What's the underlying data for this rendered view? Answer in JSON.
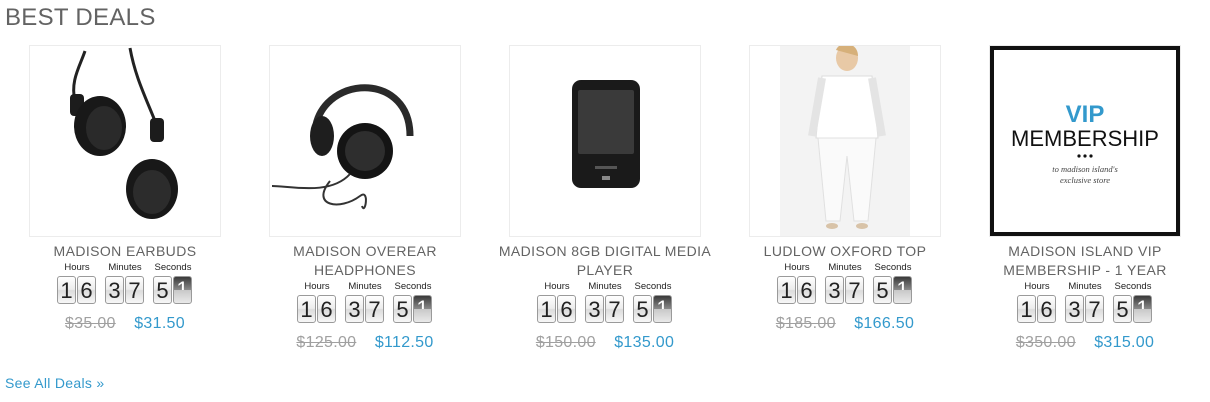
{
  "section": {
    "title": "BEST DEALS",
    "see_all": "See All Deals »"
  },
  "timer_labels": {
    "hours": "Hours",
    "minutes": "Minutes",
    "seconds": "Seconds"
  },
  "colors": {
    "price_special": "#3399cc",
    "price_old": "#a0a0a0",
    "title": "#636363"
  },
  "products": [
    {
      "name": "MADISON EARBUDS",
      "image": "earbuds-image",
      "digits": [
        "1",
        "6",
        "3",
        "7",
        "5",
        "1"
      ],
      "old_price": "$35.00",
      "price": "$31.50"
    },
    {
      "name": "MADISON OVEREAR HEADPHONES",
      "image": "headphones-image",
      "digits": [
        "1",
        "6",
        "3",
        "7",
        "5",
        "1"
      ],
      "old_price": "$125.00",
      "price": "$112.50"
    },
    {
      "name": "MADISON 8GB DIGITAL MEDIA PLAYER",
      "image": "media-player-image",
      "digits": [
        "1",
        "6",
        "3",
        "7",
        "5",
        "1"
      ],
      "old_price": "$150.00",
      "price": "$135.00"
    },
    {
      "name": "LUDLOW OXFORD TOP",
      "image": "oxford-top-image",
      "digits": [
        "1",
        "6",
        "3",
        "7",
        "5",
        "1"
      ],
      "old_price": "$185.00",
      "price": "$166.50"
    },
    {
      "name": "MADISON ISLAND VIP MEMBERSHIP - 1 YEAR",
      "image": "vip-membership-image",
      "digits": [
        "1",
        "6",
        "3",
        "7",
        "5",
        "1"
      ],
      "old_price": "$350.00",
      "price": "$315.00",
      "image_text": {
        "vip": "VIP",
        "membership": "MEMBERSHIP",
        "line1": "to madison island's",
        "line2": "exclusive store"
      }
    }
  ]
}
